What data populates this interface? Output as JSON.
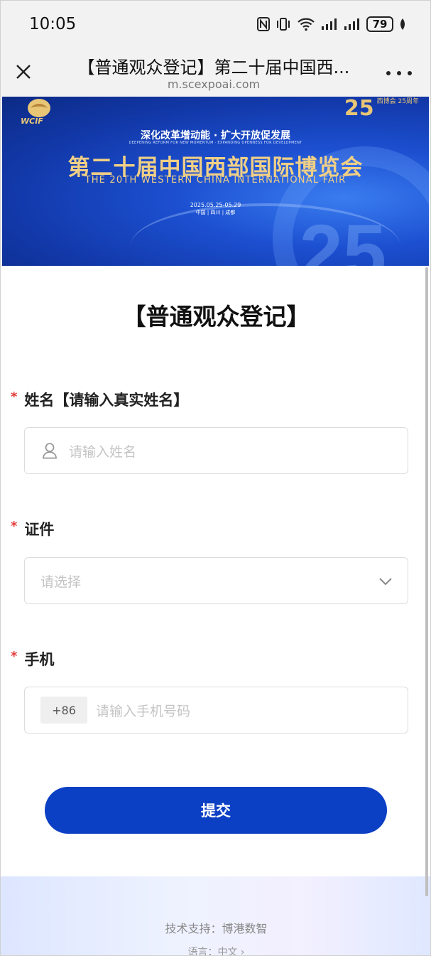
{
  "status_bar": {
    "time": "10:05",
    "battery": "79",
    "icons": [
      "nfc-icon",
      "vibrate-icon",
      "wifi-icon",
      "signal-icon",
      "signal-icon",
      "battery-icon",
      "leaf-icon"
    ]
  },
  "browser": {
    "title": "【普通观众登记】第二十届中国西...",
    "url": "m.scexpoai.com"
  },
  "banner": {
    "logo_text": "WCIF",
    "anniversary_num": "25",
    "anniversary_text": "西博会 25周年",
    "slogan": "深化改革增动能 · 扩大开放促发展",
    "slogan_en": "DEEPENING REFORM FOR NEW MOMENTUM · EXPANDING OPENNESS FOR DEVELOPMENT",
    "title": "第二十届中国西部国际博览会",
    "title_en": "THE 20TH WESTERN CHINA INTERNATIONAL FAIR",
    "date": "2025.05.25-05.29",
    "place": "中国 | 四川 | 成都",
    "big_num": "25"
  },
  "form": {
    "title": "【普通观众登记】",
    "name_label": "姓名【请输入真实姓名】",
    "name_placeholder": "请输入姓名",
    "id_label": "证件",
    "id_placeholder": "请选择",
    "phone_label": "手机",
    "country_code": "+86",
    "phone_placeholder": "请输入手机号码",
    "required_mark": "*",
    "submit_label": "提交"
  },
  "footer": {
    "support": "技术支持：博港数智",
    "language": "语言：中文 ›"
  },
  "colors": {
    "primary": "#0b3fc4",
    "required": "#e23a3a",
    "banner_gold": "#f0cf86"
  }
}
